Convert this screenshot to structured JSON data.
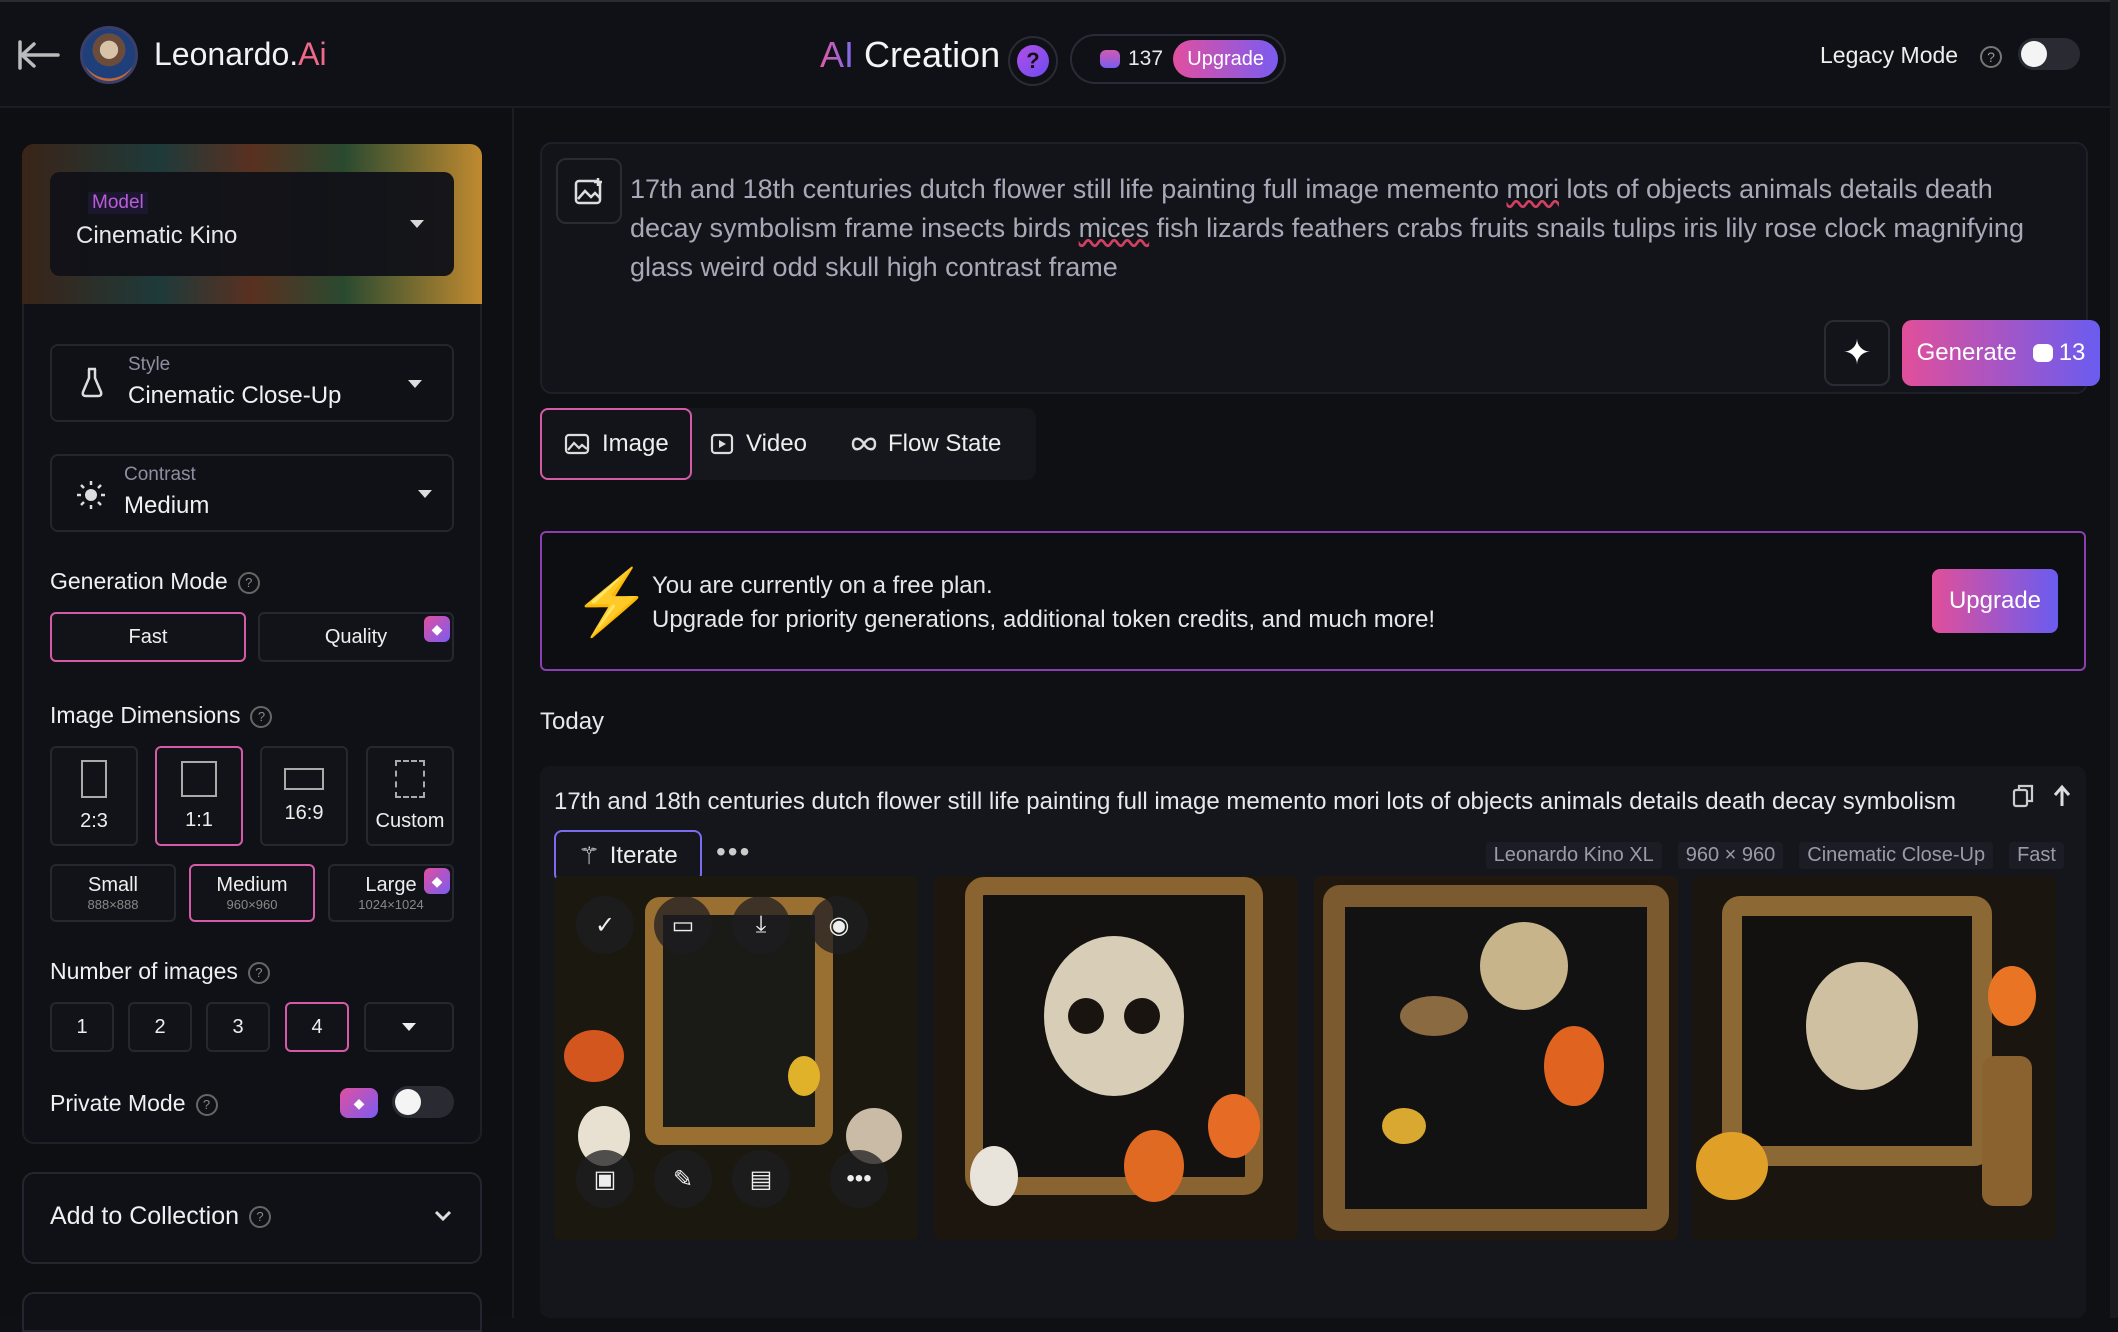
{
  "header": {
    "brand_name": "Leonardo.",
    "brand_suffix": "Ai",
    "title_prefix": "AI",
    "title": "Creation",
    "token_count": "137",
    "upgrade_label": "Upgrade",
    "legacy_label": "Legacy Mode",
    "legacy_enabled": false
  },
  "sidebar": {
    "model_label": "Model",
    "model_value": "Cinematic Kino",
    "style_label": "Style",
    "style_value": "Cinematic Close-Up",
    "contrast_label": "Contrast",
    "contrast_value": "Medium",
    "gen_mode_title": "Generation Mode",
    "gen_modes": [
      "Fast",
      "Quality"
    ],
    "dimensions_title": "Image Dimensions",
    "aspect_ratios": [
      "2:3",
      "1:1",
      "16:9",
      "Custom"
    ],
    "sizes": [
      {
        "label": "Small",
        "px": "888×888"
      },
      {
        "label": "Medium",
        "px": "960×960"
      },
      {
        "label": "Large",
        "px": "1024×1024"
      }
    ],
    "num_images_title": "Number of images",
    "num_images": [
      "1",
      "2",
      "3",
      "4"
    ],
    "private_mode_label": "Private Mode",
    "private_enabled": false,
    "collection_label": "Add to Collection"
  },
  "prompt": {
    "text_1": "17th and 18th centuries dutch flower still life painting full image memento ",
    "text_mori": "mori",
    "text_2": " lots of objects animals details death decay symbolism frame insects birds ",
    "text_mices": "mices",
    "text_3": " fish lizards feathers crabs fruits  snails tulips iris lily rose clock magnifying glass weird odd skull high contrast  frame",
    "generate_label": "Generate",
    "generate_cost": "13"
  },
  "tabs": [
    "Image",
    "Video",
    "Flow State"
  ],
  "banner": {
    "line1": "You are currently on a free plan.",
    "line2": "Upgrade for priority generations, additional token credits, and much more!",
    "button": "Upgrade"
  },
  "feed": {
    "section": "Today",
    "prompt": "17th and 18th centuries dutch flower still life painting full image memento mori lots of objects animals details death decay symbolism",
    "iterate_label": "Iterate",
    "meta_model": "Leonardo Kino XL",
    "meta_size": "960 × 960",
    "meta_style": "Cinematic Close-Up",
    "meta_speed": "Fast"
  },
  "colors": {
    "accent_pink": "#e14f9a",
    "accent_purple": "#6a5cf0",
    "bg": "#0f1014"
  }
}
